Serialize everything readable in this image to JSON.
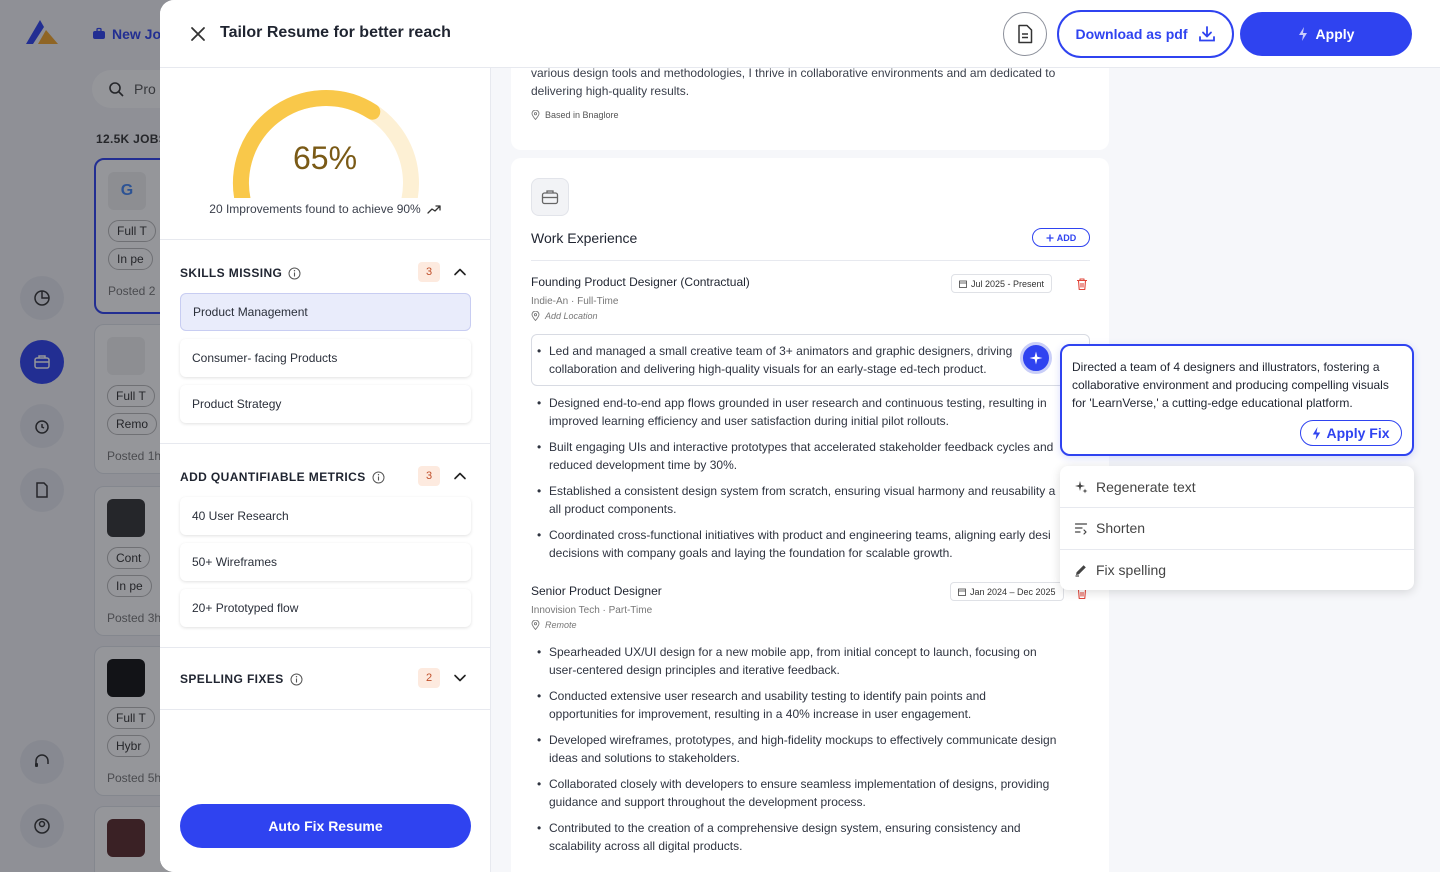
{
  "background": {
    "new_job_label": "New Jo",
    "search_placeholder": "Pro",
    "jobs_count": "12.5K JOBS",
    "cards": [
      {
        "letter": "G",
        "chips": [
          "Full T",
          "In pe"
        ],
        "posted": "Posted 2"
      },
      {
        "letter": "",
        "chips": [
          "Full T",
          "Remo"
        ],
        "posted": "Posted 1h"
      },
      {
        "letter": "",
        "chips": [
          "Cont",
          "In pe"
        ],
        "posted": "Posted 3h"
      },
      {
        "letter": "",
        "chips": [
          "Full T",
          "Hybr"
        ],
        "posted": "Posted 5h"
      }
    ]
  },
  "header": {
    "title": "Tailor Resume for better reach",
    "download_label": "Download as pdf",
    "apply_label": "Apply"
  },
  "score": {
    "value": "65%",
    "progress": 0.65,
    "caption": "20 Improvements found to achieve 90%"
  },
  "sections": {
    "skills": {
      "title": "SKILLS MISSING",
      "count": "3",
      "items": [
        "Product Management",
        "Consumer- facing Products",
        "Product Strategy"
      ]
    },
    "metrics": {
      "title": "ADD QUANTIFIABLE METRICS",
      "count": "3",
      "items": [
        "40 User Research",
        "50+ Wireframes",
        "20+ Prototyped flow"
      ]
    },
    "spelling": {
      "title": "SPELLING FIXES",
      "count": "2"
    }
  },
  "auto_fix_label": "Auto Fix Resume",
  "resume": {
    "summary": "various design tools and methodologies, I thrive in collaborative environments and am dedicated to delivering high-quality results.",
    "based_in": "Based in  Bnaglore",
    "work_title": "Work Experience",
    "add_label": "ADD",
    "jobs": [
      {
        "title": "Founding Product Designer (Contractual)",
        "meta": "Indie-An · Full-Time",
        "location": "Add Location",
        "date": "Jul 2025  -  Present",
        "bullets": [
          "Led and managed a small creative team of 3+ animators and graphic designers, driving collaboration and delivering high-quality visuals for an early-stage ed-tech product.",
          "Designed end-to-end app flows grounded in user research and continuous testing, resulting in improved learning efficiency and user satisfaction during initial pilot rollouts.",
          "Built engaging UIs and interactive prototypes that accelerated stakeholder feedback cycles and reduced development time by 30%.",
          "Established a consistent design system from scratch, ensuring visual harmony and reusability a all product components.",
          "Coordinated cross-functional initiatives with product and engineering teams, aligning early desi decisions with company goals and laying the foundation for scalable growth."
        ]
      },
      {
        "title": "Senior Product Designer",
        "meta": "Innovision Tech · Part-Time",
        "location": "Remote",
        "date": "Jan 2024 – Dec 2025",
        "bullets": [
          "Spearheaded UX/UI design for a new mobile app, from initial concept to launch, focusing on user-centered design principles and iterative feedback.",
          "Conducted extensive user research and usability testing to identify pain points and opportunities for improvement, resulting in a 40% increase in user engagement.",
          "Developed wireframes, prototypes, and high-fidelity mockups to effectively communicate design ideas and solutions to stakeholders.",
          "Collaborated closely with developers to ensure seamless implementation of designs, providing guidance and support throughout the development process.",
          "Contributed to the creation of a comprehensive design system, ensuring consistency and scalability across all digital products."
        ]
      }
    ]
  },
  "suggestion": {
    "text": "Directed a team of 4 designers and illustrators, fostering a collaborative environment and producing compelling visuals for 'LearnVerse,' a cutting-edge educational platform.",
    "apply_label": "Apply Fix"
  },
  "menu": {
    "items": [
      "Regenerate text",
      "Shorten",
      "Fix spelling"
    ]
  },
  "colors": {
    "primary": "#2f43f0",
    "gauge_fill": "#f9c84a",
    "gauge_track": "#fdf0d4",
    "badge_bg": "#fdeadf",
    "badge_text": "#c0502b",
    "danger": "#e0453a"
  }
}
